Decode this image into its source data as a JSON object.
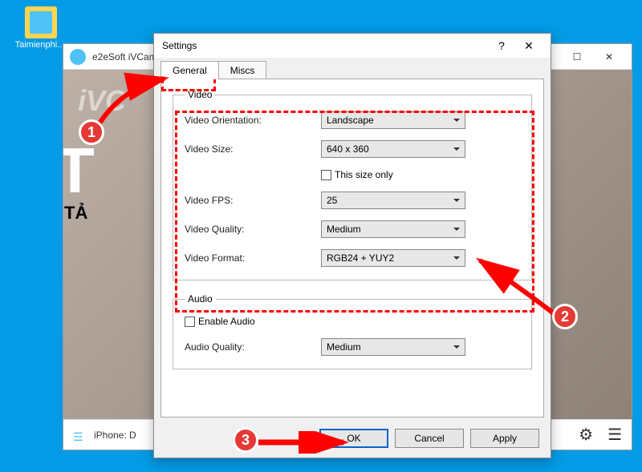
{
  "desktop_icon_label": "Taimienphi....",
  "app": {
    "title": "e2eSoft iVCam",
    "watermark": "iVC",
    "big_text": "T",
    "sub_text": "TẢ",
    "status": "iPhone: D",
    "gear_icon": "⚙",
    "menu_icon": "☰",
    "min": "—",
    "max": "☐",
    "close": "✕"
  },
  "settings": {
    "title": "Settings",
    "help": "?",
    "close": "✕",
    "tabs": {
      "general": "General",
      "miscs": "Miscs"
    },
    "video": {
      "legend": "Video",
      "orientation_label": "Video Orientation:",
      "orientation_value": "Landscape",
      "size_label": "Video Size:",
      "size_value": "640 x 360",
      "size_only_label": "This size only",
      "fps_label": "Video FPS:",
      "fps_value": "25",
      "quality_label": "Video Quality:",
      "quality_value": "Medium",
      "format_label": "Video Format:",
      "format_value": "RGB24 + YUY2"
    },
    "audio": {
      "legend": "Audio",
      "enable_label": "Enable Audio",
      "quality_label": "Audio Quality:",
      "quality_value": "Medium"
    },
    "buttons": {
      "ok": "OK",
      "cancel": "Cancel",
      "apply": "Apply"
    }
  },
  "annotations": {
    "n1": "1",
    "n2": "2",
    "n3": "3"
  }
}
